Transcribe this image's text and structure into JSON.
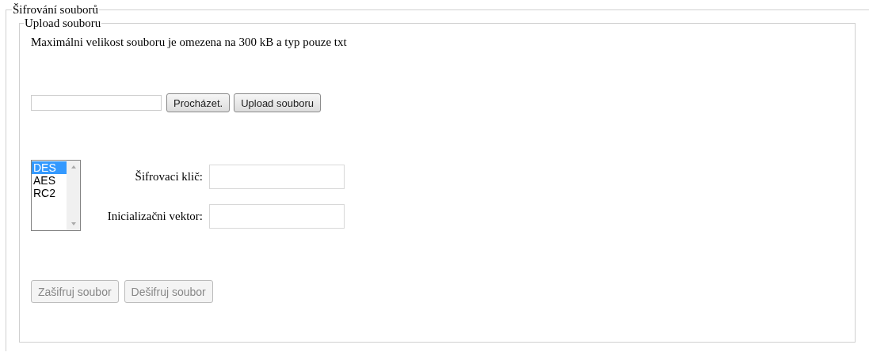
{
  "outer": {
    "legend": "Šifrování souborů"
  },
  "upload": {
    "legend": "Upload souboru",
    "note": "Maximálni velikost souboru je omezena na 300 kB a typ pouze txt",
    "browse_button": "Procházet.",
    "upload_button": "Upload souboru"
  },
  "algorithms": [
    {
      "label": "DES",
      "selected": true
    },
    {
      "label": "AES",
      "selected": false
    },
    {
      "label": "RC2",
      "selected": false
    }
  ],
  "fields": [
    {
      "label": "Šifrovaci klič:"
    },
    {
      "label": "Inicializačni vektor:"
    }
  ],
  "buttons": [
    {
      "label": "Zašifruj soubor",
      "disabled": true
    },
    {
      "label": "Dešifruj soubor",
      "disabled": true
    }
  ]
}
